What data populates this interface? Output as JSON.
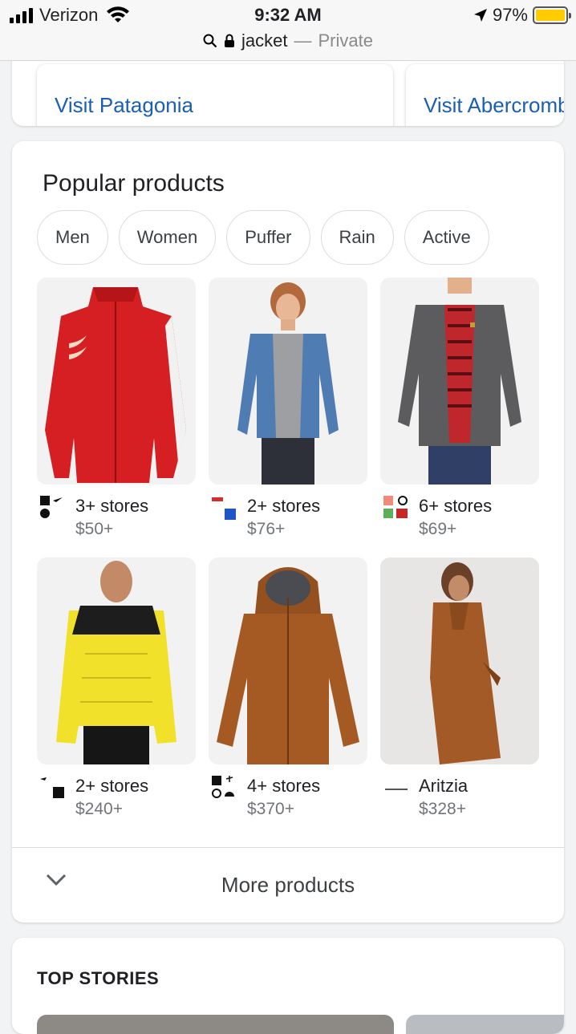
{
  "status_bar": {
    "carrier": "Verizon",
    "time": "9:32 AM",
    "battery": "97%",
    "battery_color": "#ffcc00"
  },
  "url_bar": {
    "query": "jacket",
    "separator": "—",
    "mode": "Private"
  },
  "visit_links": [
    "Visit Patagonia",
    "Visit Abercrombie"
  ],
  "popular_products": {
    "title": "Popular products",
    "chips": [
      "Men",
      "Women",
      "Puffer",
      "Rain",
      "Active"
    ],
    "products": [
      {
        "line1": "3+ stores",
        "price": "$50+",
        "image": "red-track-jacket"
      },
      {
        "line1": "2+ stores",
        "price": "$76+",
        "image": "denim-jacket"
      },
      {
        "line1": "6+ stores",
        "price": "$69+",
        "image": "grey-field-jacket"
      },
      {
        "line1": "2+ stores",
        "price": "$240+",
        "image": "yellow-puffer-jacket"
      },
      {
        "line1": "4+ stores",
        "price": "$370+",
        "image": "brown-hooded-jacket"
      },
      {
        "line1": "Aritzia",
        "price": "$328+",
        "image": "camel-wool-coat"
      }
    ],
    "more_label": "More products"
  },
  "top_stories": {
    "title": "TOP STORIES"
  }
}
